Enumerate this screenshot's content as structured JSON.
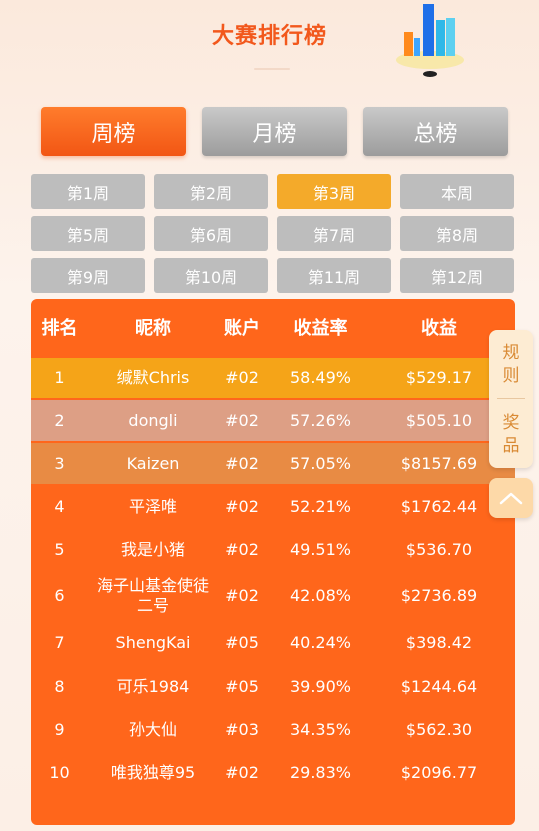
{
  "header": {
    "title": "大赛排行榜"
  },
  "main_tabs": [
    {
      "label": "周榜",
      "active": true
    },
    {
      "label": "月榜",
      "active": false
    },
    {
      "label": "总榜",
      "active": false
    }
  ],
  "weeks": [
    {
      "label": "第1周"
    },
    {
      "label": "第2周"
    },
    {
      "label": "第3周",
      "active": true
    },
    {
      "label": "本周"
    },
    {
      "label": "第5周"
    },
    {
      "label": "第6周"
    },
    {
      "label": "第7周"
    },
    {
      "label": "第8周"
    },
    {
      "label": "第9周"
    },
    {
      "label": "第10周"
    },
    {
      "label": "第11周"
    },
    {
      "label": "第12周"
    }
  ],
  "table": {
    "headers": {
      "rank": "排名",
      "nickname": "昵称",
      "account": "账户",
      "rate": "收益率",
      "profit": "收益"
    },
    "rows": [
      {
        "rank": "1",
        "nickname": "缄默Chris",
        "account": "#02",
        "rate": "58.49%",
        "profit": "$529.17"
      },
      {
        "rank": "2",
        "nickname": "dongli",
        "account": "#02",
        "rate": "57.26%",
        "profit": "$505.10"
      },
      {
        "rank": "3",
        "nickname": "Kaizen",
        "account": "#02",
        "rate": "57.05%",
        "profit": "$8157.69"
      },
      {
        "rank": "4",
        "nickname": "平泽唯",
        "account": "#02",
        "rate": "52.21%",
        "profit": "$1762.44"
      },
      {
        "rank": "5",
        "nickname": "我是小猪",
        "account": "#02",
        "rate": "49.51%",
        "profit": "$536.70"
      },
      {
        "rank": "6",
        "nickname": "海子山基金使徒二号",
        "account": "#02",
        "rate": "42.08%",
        "profit": "$2736.89"
      },
      {
        "rank": "7",
        "nickname": "ShengKai",
        "account": "#05",
        "rate": "40.24%",
        "profit": "$398.42"
      },
      {
        "rank": "8",
        "nickname": "可乐1984",
        "account": "#05",
        "rate": "39.90%",
        "profit": "$1244.64"
      },
      {
        "rank": "9",
        "nickname": "孙大仙",
        "account": "#03",
        "rate": "34.35%",
        "profit": "$562.30"
      },
      {
        "rank": "10",
        "nickname": "唯我独尊95",
        "account": "#02",
        "rate": "29.83%",
        "profit": "$2096.77"
      }
    ]
  },
  "side": {
    "rules": "规则",
    "prizes": "奖品",
    "top_icon": "chevron-up-icon"
  },
  "colors": {
    "accent": "#ff661b",
    "title": "#f2581c",
    "active_week": "#f4aa2a",
    "rank1": "#f5a418",
    "rank2": "#dd9f85",
    "rank3": "#e88b44"
  }
}
